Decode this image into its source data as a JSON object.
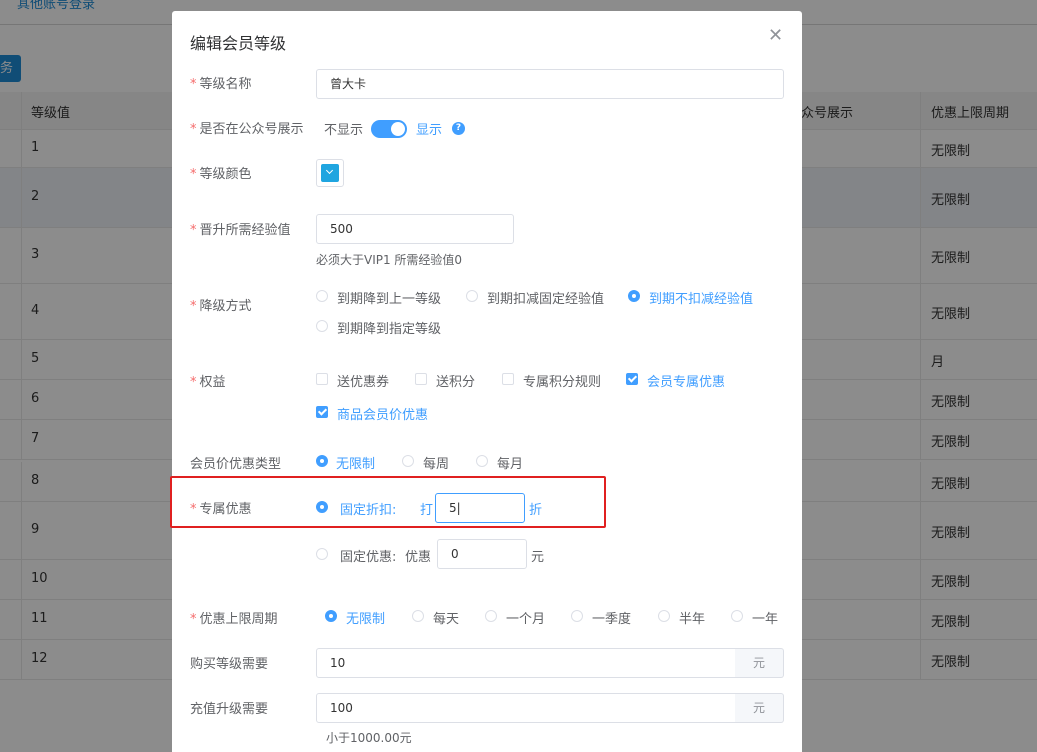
{
  "background": {
    "top_link": "其他账号登录",
    "action_button": "务",
    "table": {
      "col_level": "等级值",
      "col_mp": "众号展示",
      "col_cycle": "优惠上限周期",
      "rows": [
        {
          "level": "1",
          "cycle": "无限制"
        },
        {
          "level": "2",
          "cycle": "无限制"
        },
        {
          "level": "3",
          "cycle": "无限制"
        },
        {
          "level": "4",
          "cycle": "无限制"
        },
        {
          "level": "5",
          "cycle": "月"
        },
        {
          "level": "6",
          "cycle": "无限制"
        },
        {
          "level": "7",
          "cycle": "无限制"
        },
        {
          "level": "8",
          "cycle": "无限制"
        },
        {
          "level": "9",
          "cycle": "无限制"
        },
        {
          "level": "10",
          "cycle": "无限制"
        },
        {
          "level": "11",
          "cycle": "无限制"
        },
        {
          "level": "12",
          "cycle": "无限制"
        }
      ]
    }
  },
  "dialog": {
    "title": "编辑会员等级",
    "close_icon": "close-icon",
    "level_name": {
      "label": "等级名称",
      "value": "曾大卡"
    },
    "show_in_mp": {
      "label": "是否在公众号展示",
      "off_text": "不显示",
      "on_text": "显示",
      "state": true
    },
    "level_color": {
      "label": "等级颜色",
      "color": "#1fa5e0"
    },
    "upgrade_exp": {
      "label": "晋升所需经验值",
      "value": "500",
      "hint": "必须大于VIP1 所需经验值0"
    },
    "downgrade": {
      "label": "降级方式",
      "options": [
        "到期降到上一等级",
        "到期扣减固定经验值",
        "到期不扣减经验值",
        "到期降到指定等级"
      ],
      "selected": "到期不扣减经验值"
    },
    "benefits": {
      "label": "权益",
      "options": [
        "送优惠券",
        "送积分",
        "专属积分规则",
        "会员专属优惠",
        "商品会员价优惠"
      ],
      "checked": [
        "会员专属优惠",
        "商品会员价优惠"
      ]
    },
    "member_price_type": {
      "label": "会员价优惠类型",
      "options": [
        "无限制",
        "每周",
        "每月"
      ],
      "selected": "无限制"
    },
    "exclusive_discount": {
      "label": "专属优惠",
      "fixed_rate_label": "固定折扣:",
      "prefix": "打",
      "rate_value": "5",
      "rate_suffix": "折",
      "fixed_amount_label": "固定优惠:",
      "amount_prefix": "优惠",
      "amount_value": "0",
      "amount_suffix": "元",
      "selected": "固定折扣:"
    },
    "discount_cycle": {
      "label": "优惠上限周期",
      "options": [
        "无限制",
        "每天",
        "一个月",
        "一季度",
        "半年",
        "一年"
      ],
      "selected": "无限制"
    },
    "purchase_required": {
      "label": "购买等级需要",
      "value": "10",
      "unit": "元"
    },
    "recharge_required": {
      "label": "充值升级需要",
      "value": "100",
      "unit": "元",
      "hint": "小于1000.00元"
    }
  }
}
